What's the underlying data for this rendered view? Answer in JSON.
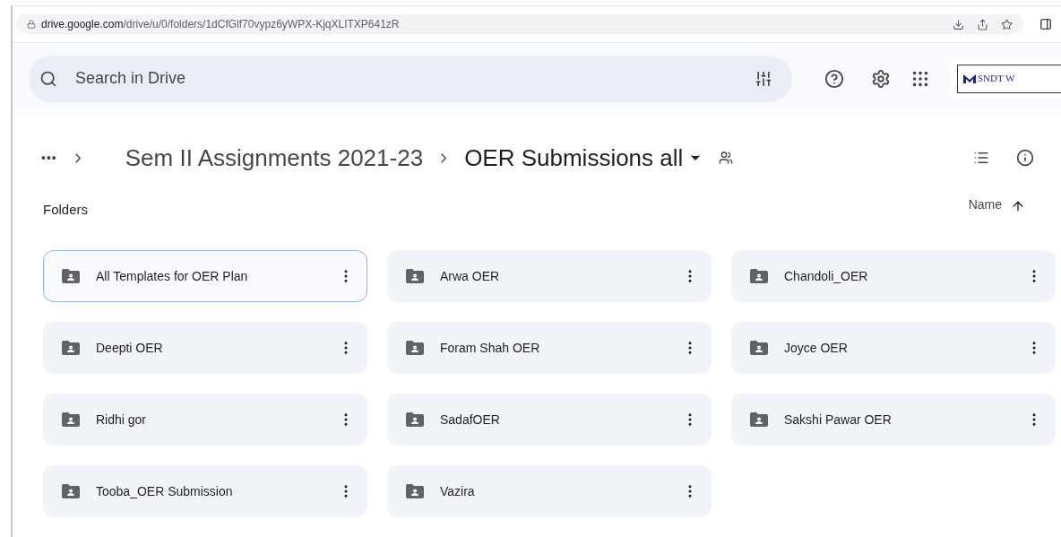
{
  "address_bar": {
    "domain": "drive.google.com",
    "path": "/drive/u/0/folders/1dCfGlf70vypz6yWPX-KjqXLITXP641zR"
  },
  "search": {
    "placeholder": "Search in Drive"
  },
  "account_logo": {
    "text": "SNDT W"
  },
  "breadcrumb": {
    "overflow": "•••",
    "items": [
      "Sem II Assignments 2021-23",
      "OER Submissions all"
    ]
  },
  "section_title": "Folders",
  "sort": {
    "label": "Name"
  },
  "folders": [
    {
      "name": "All Templates for OER Plan",
      "selected": true
    },
    {
      "name": "Arwa OER",
      "selected": false
    },
    {
      "name": "Chandoli_OER",
      "selected": false
    },
    {
      "name": "Deepti OER",
      "selected": false
    },
    {
      "name": "Foram Shah OER",
      "selected": false
    },
    {
      "name": "Joyce OER",
      "selected": false
    },
    {
      "name": "Ridhi gor",
      "selected": false
    },
    {
      "name": "SadafOER",
      "selected": false
    },
    {
      "name": "Sakshi Pawar OER",
      "selected": false
    },
    {
      "name": "Tooba_OER Submission",
      "selected": false
    },
    {
      "name": "Vazira",
      "selected": false
    }
  ]
}
